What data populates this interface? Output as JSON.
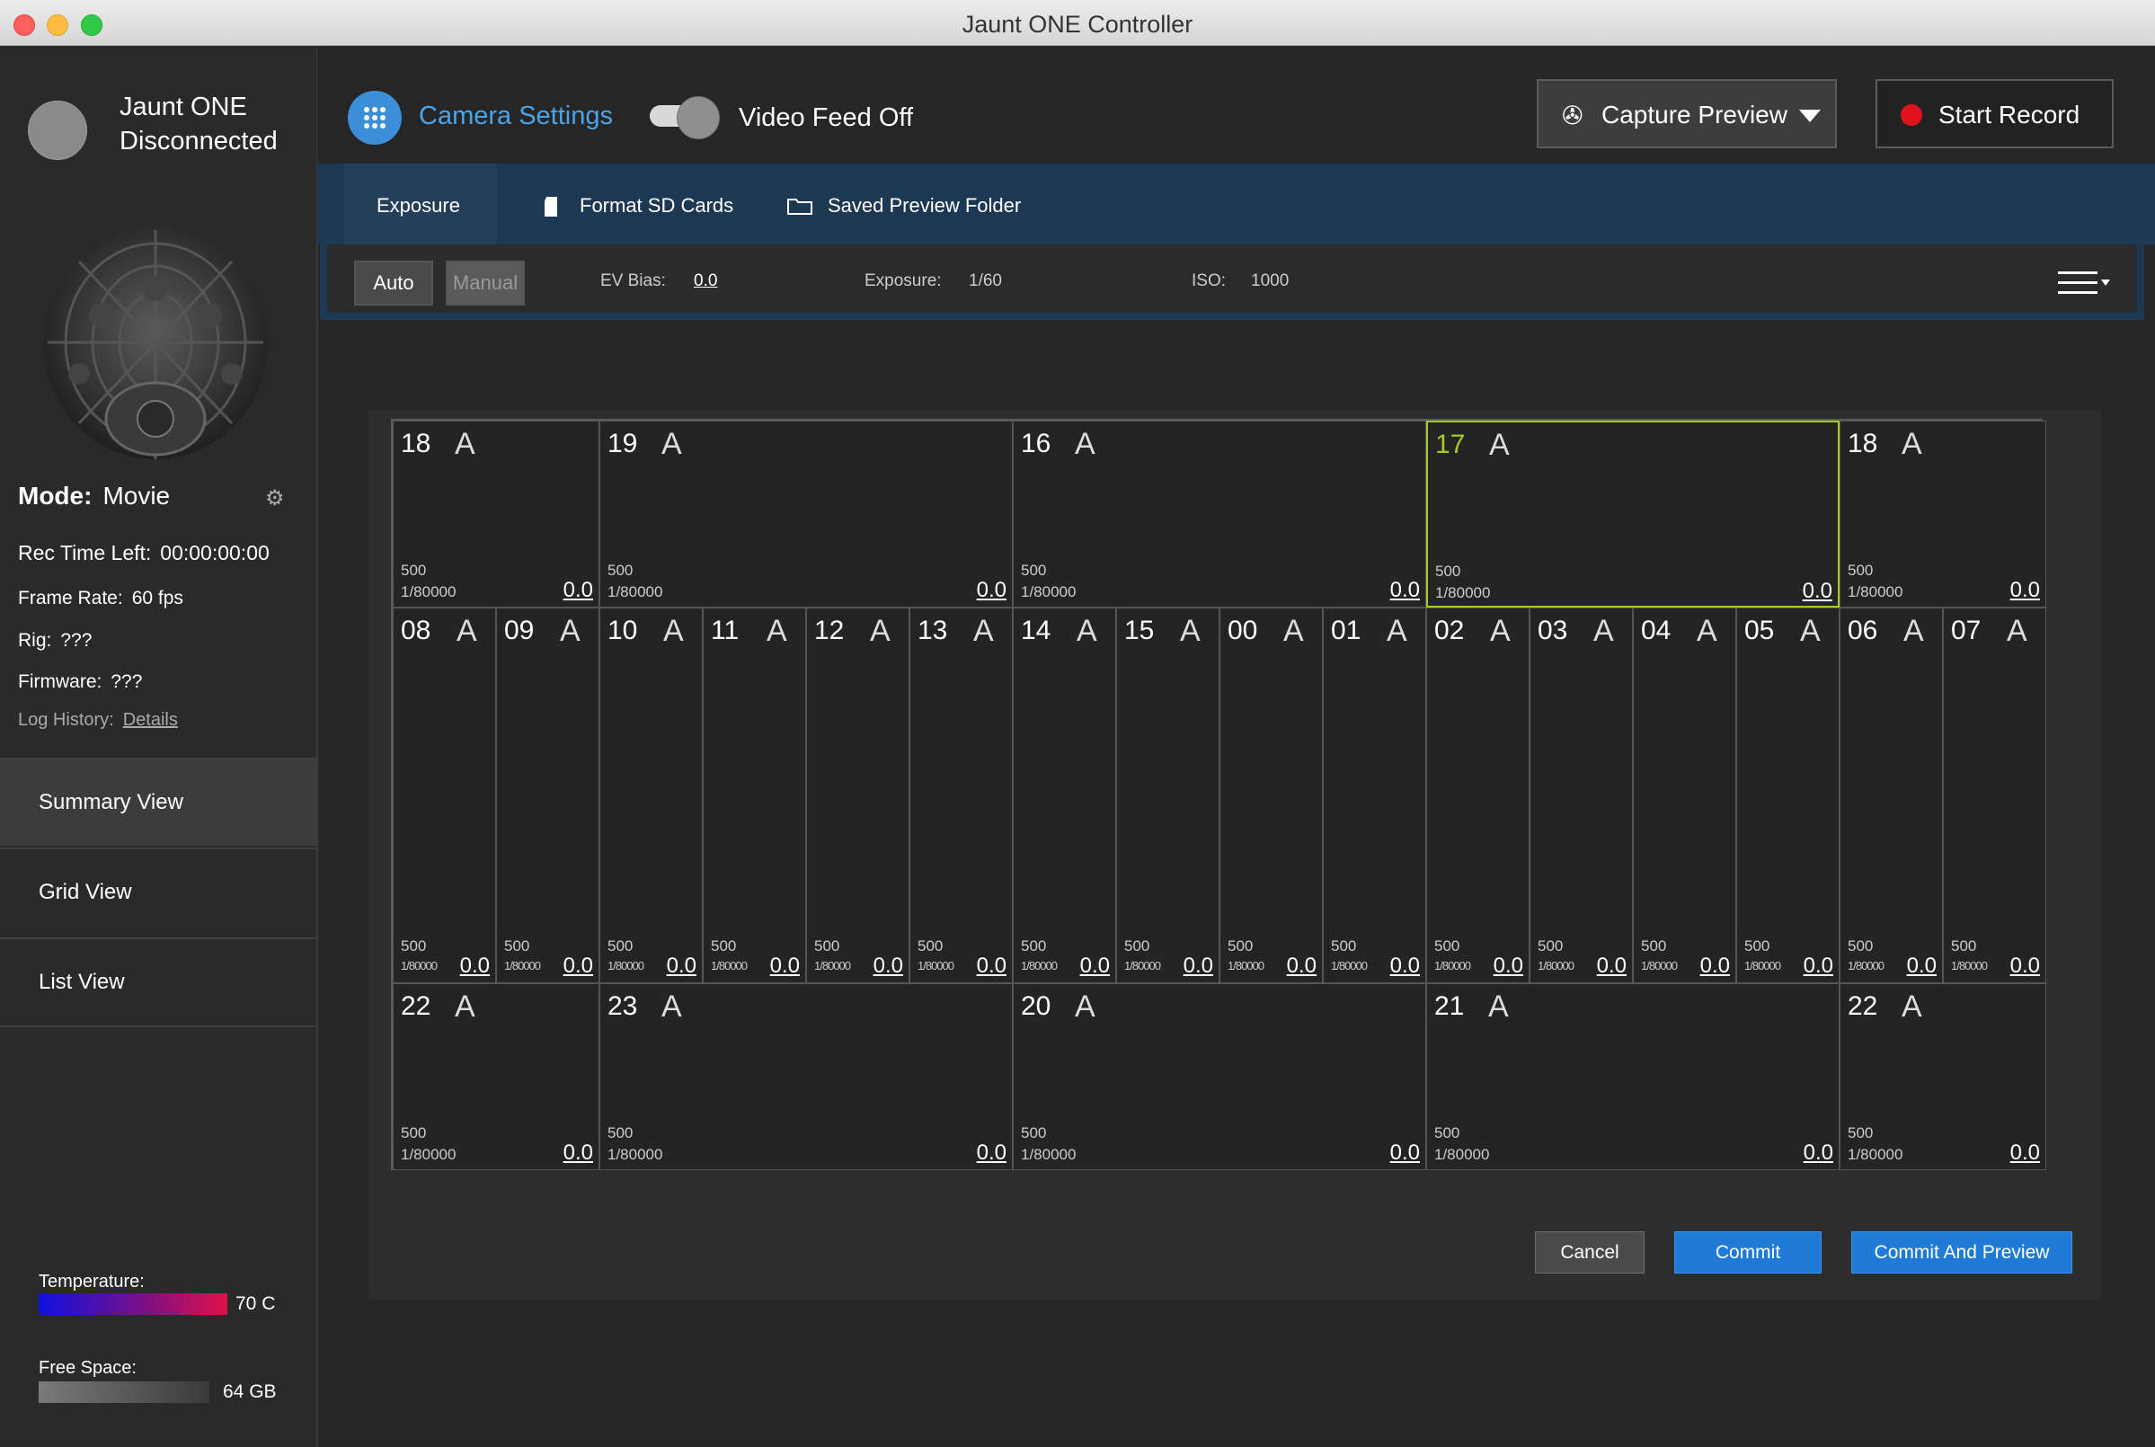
{
  "window": {
    "title": "Jaunt ONE Controller"
  },
  "sidebar": {
    "device_name": "Jaunt ONE",
    "device_status": "Disconnected",
    "mode_label": "Mode:",
    "mode_value": "Movie",
    "rec_time_label": "Rec Time Left:",
    "rec_time_value": "00:00:00:00",
    "frame_rate_label": "Frame Rate:",
    "frame_rate_value": "60 fps",
    "rig_label": "Rig:",
    "rig_value": "???",
    "firmware_label": "Firmware:",
    "firmware_value": "???",
    "log_label": "Log History:",
    "log_link": "Details",
    "nav": [
      "Summary View",
      "Grid View",
      "List View"
    ],
    "temperature_label": "Temperature:",
    "temperature_value": "70 C",
    "free_space_label": "Free Space:",
    "free_space_value": "64 GB"
  },
  "header": {
    "camera_settings": "Camera Settings",
    "video_feed": "Video Feed Off",
    "capture_preview": "Capture Preview",
    "start_record": "Start Record"
  },
  "subtabs": {
    "exposure": "Exposure",
    "format_sd": "Format SD Cards",
    "saved_preview": "Saved Preview Folder"
  },
  "exposure_bar": {
    "auto": "Auto",
    "manual": "Manual",
    "ev_label": "EV Bias:",
    "ev_value": "0.0",
    "exposure_label": "Exposure:",
    "exposure_value": "1/60",
    "iso_label": "ISO:",
    "iso_value": "1000"
  },
  "grid": {
    "rows": [
      {
        "cells": [
          {
            "id": "18",
            "mode": "A",
            "iso": "500",
            "shutter": "1/80000",
            "ev": "0.0"
          },
          {
            "id": "19",
            "mode": "A",
            "iso": "500",
            "shutter": "1/80000",
            "ev": "0.0"
          },
          {
            "id": "16",
            "mode": "A",
            "iso": "500",
            "shutter": "1/80000",
            "ev": "0.0"
          },
          {
            "id": "17",
            "mode": "A",
            "iso": "500",
            "shutter": "1/80000",
            "ev": "0.0",
            "selected": true
          },
          {
            "id": "18",
            "mode": "A",
            "iso": "500",
            "shutter": "1/80000",
            "ev": "0.0"
          }
        ]
      },
      {
        "cells": [
          {
            "id": "08",
            "mode": "A",
            "iso": "500",
            "shutter": "1/80000",
            "ev": "0.0"
          },
          {
            "id": "09",
            "mode": "A",
            "iso": "500",
            "shutter": "1/80000",
            "ev": "0.0"
          },
          {
            "id": "10",
            "mode": "A",
            "iso": "500",
            "shutter": "1/80000",
            "ev": "0.0"
          },
          {
            "id": "11",
            "mode": "A",
            "iso": "500",
            "shutter": "1/80000",
            "ev": "0.0"
          },
          {
            "id": "12",
            "mode": "A",
            "iso": "500",
            "shutter": "1/80000",
            "ev": "0.0"
          },
          {
            "id": "13",
            "mode": "A",
            "iso": "500",
            "shutter": "1/80000",
            "ev": "0.0"
          },
          {
            "id": "14",
            "mode": "A",
            "iso": "500",
            "shutter": "1/80000",
            "ev": "0.0"
          },
          {
            "id": "15",
            "mode": "A",
            "iso": "500",
            "shutter": "1/80000",
            "ev": "0.0"
          },
          {
            "id": "00",
            "mode": "A",
            "iso": "500",
            "shutter": "1/80000",
            "ev": "0.0"
          },
          {
            "id": "01",
            "mode": "A",
            "iso": "500",
            "shutter": "1/80000",
            "ev": "0.0"
          },
          {
            "id": "02",
            "mode": "A",
            "iso": "500",
            "shutter": "1/80000",
            "ev": "0.0"
          },
          {
            "id": "03",
            "mode": "A",
            "iso": "500",
            "shutter": "1/80000",
            "ev": "0.0"
          },
          {
            "id": "04",
            "mode": "A",
            "iso": "500",
            "shutter": "1/80000",
            "ev": "0.0"
          },
          {
            "id": "05",
            "mode": "A",
            "iso": "500",
            "shutter": "1/80000",
            "ev": "0.0"
          },
          {
            "id": "06",
            "mode": "A",
            "iso": "500",
            "shutter": "1/80000",
            "ev": "0.0"
          },
          {
            "id": "07",
            "mode": "A",
            "iso": "500",
            "shutter": "1/80000",
            "ev": "0.0"
          }
        ]
      },
      {
        "cells": [
          {
            "id": "22",
            "mode": "A",
            "iso": "500",
            "shutter": "1/80000",
            "ev": "0.0"
          },
          {
            "id": "23",
            "mode": "A",
            "iso": "500",
            "shutter": "1/80000",
            "ev": "0.0"
          },
          {
            "id": "20",
            "mode": "A",
            "iso": "500",
            "shutter": "1/80000",
            "ev": "0.0"
          },
          {
            "id": "21",
            "mode": "A",
            "iso": "500",
            "shutter": "1/80000",
            "ev": "0.0"
          },
          {
            "id": "22",
            "mode": "A",
            "iso": "500",
            "shutter": "1/80000",
            "ev": "0.0"
          }
        ]
      }
    ]
  },
  "actions": {
    "cancel": "Cancel",
    "commit": "Commit",
    "commit_preview": "Commit And Preview"
  },
  "colors": {
    "accent": "#1f7bd6",
    "selected": "#a6c92b",
    "record": "#e0131c"
  }
}
